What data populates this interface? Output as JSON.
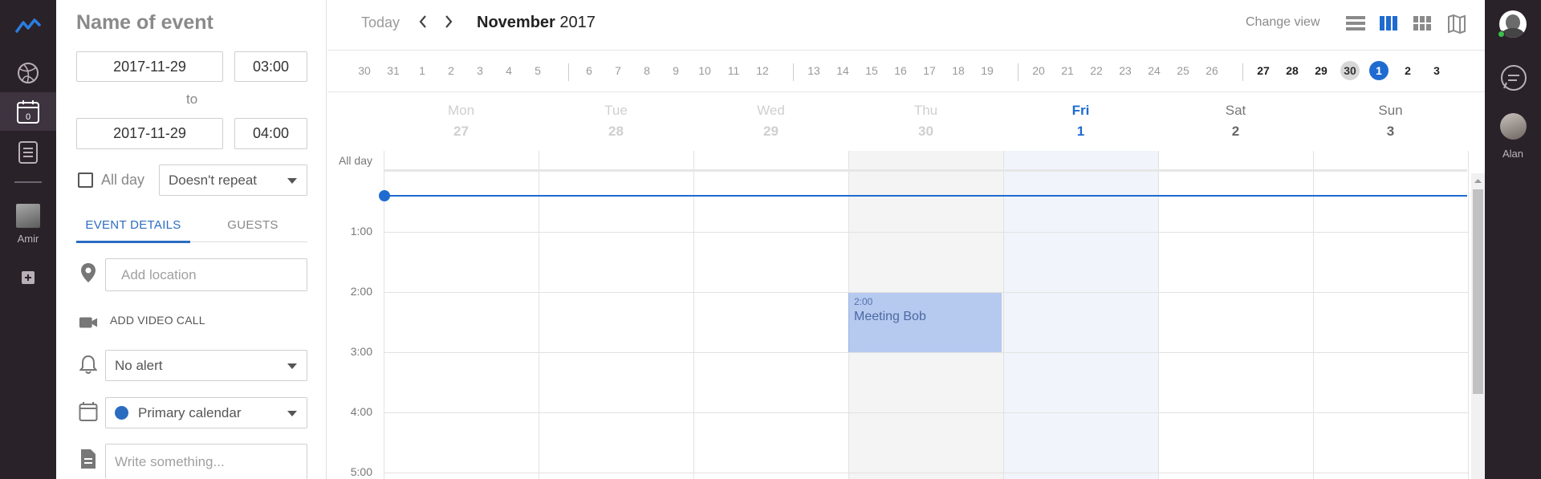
{
  "left_rail": {
    "user_name": "Amir",
    "calendar_badge": "0"
  },
  "right_rail": {
    "user_name": "Alan"
  },
  "event_form": {
    "title_placeholder": "Name of event",
    "start_date": "2017-11-29",
    "start_time": "03:00",
    "to_label": "to",
    "end_date": "2017-11-29",
    "end_time": "04:00",
    "all_day_label": "All day",
    "repeat_value": "Doesn't repeat",
    "tabs": [
      {
        "label": "EVENT DETAILS",
        "active": true
      },
      {
        "label": "GUESTS",
        "active": false
      }
    ],
    "location_placeholder": "Add location",
    "video_call_label": "ADD VIDEO CALL",
    "alert_value": "No alert",
    "calendar_value": "Primary calendar",
    "calendar_color": "#2b6cc0",
    "notes_placeholder": "Write something..."
  },
  "calendar": {
    "today_label": "Today",
    "month_name": "November",
    "year": "2017",
    "change_view_label": "Change view",
    "strip_days": [
      "30",
      "31",
      "1",
      "2",
      "3",
      "4",
      "5",
      "6",
      "7",
      "8",
      "9",
      "10",
      "11",
      "12",
      "13",
      "14",
      "15",
      "16",
      "17",
      "18",
      "19",
      "20",
      "21",
      "22",
      "23",
      "24",
      "25",
      "26",
      "27",
      "28",
      "29",
      "30",
      "1",
      "2",
      "3"
    ],
    "selected_day": "30",
    "today_day": "1",
    "week_days": [
      {
        "name": "Mon",
        "num": "27"
      },
      {
        "name": "Tue",
        "num": "28"
      },
      {
        "name": "Wed",
        "num": "29"
      },
      {
        "name": "Thu",
        "num": "30"
      },
      {
        "name": "Fri",
        "num": "1"
      },
      {
        "name": "Sat",
        "num": "2"
      },
      {
        "name": "Sun",
        "num": "3"
      }
    ],
    "all_day_label": "All day",
    "hours": [
      "1:00",
      "2:00",
      "3:00",
      "4:00",
      "5:00"
    ],
    "event": {
      "time": "2:00",
      "title": "Meeting Bob",
      "color": "#b6c9ef"
    },
    "accent_color": "#1f6bd0"
  }
}
